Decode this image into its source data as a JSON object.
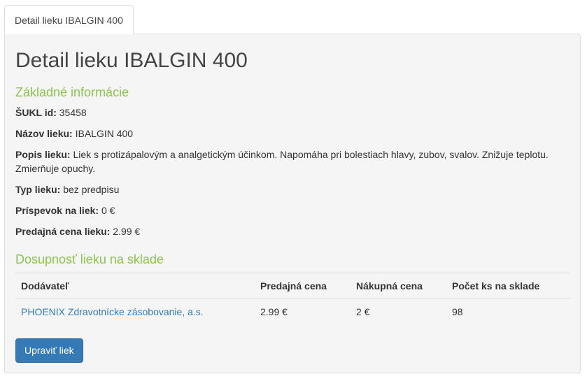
{
  "tab": {
    "label": "Detail lieku IBALGIN 400"
  },
  "page_title": "Detail lieku IBALGIN 400",
  "basic_info": {
    "heading": "Základné informácie",
    "fields": [
      {
        "label": "ŠUKL id:",
        "value": "35458"
      },
      {
        "label": "Názov lieku:",
        "value": "IBALGIN 400"
      },
      {
        "label": "Popis lieku:",
        "value": "Liek s protizápalovým a analgetickým účinkom. Napomáha pri bolestiach hlavy, zubov, svalov. Znižuje teplotu. Zmierňuje opuchy."
      },
      {
        "label": "Typ lieku:",
        "value": "bez predpisu"
      },
      {
        "label": "Príspevok na liek:",
        "value": "0 €"
      },
      {
        "label": "Predajná cena lieku:",
        "value": "2.99 €"
      }
    ]
  },
  "stock": {
    "heading": "Dosupnosť lieku na sklade",
    "columns": [
      "Dodávateľ",
      "Predajná cena",
      "Nákupná cena",
      "Počet ks na sklade"
    ],
    "rows": [
      {
        "supplier": "PHOENIX Zdravotnícke zásobovanie, a.s.",
        "sell_price": "2.99 €",
        "buy_price": "2 €",
        "count": "98"
      }
    ]
  },
  "actions": {
    "edit_label": "Upraviť liek"
  },
  "colors": {
    "accent_green": "#8cc34a",
    "link_blue": "#337ab7",
    "button_blue": "#337ab7"
  }
}
